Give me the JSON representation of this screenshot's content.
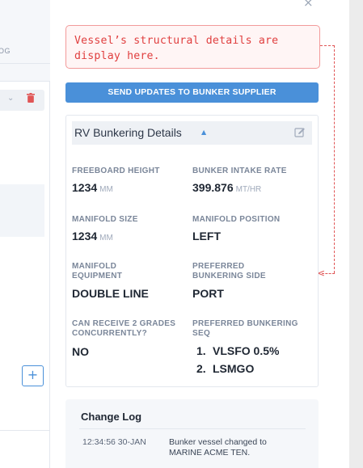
{
  "left": {
    "tab_fragment": "OG",
    "add_label": "+"
  },
  "close_label": "×",
  "tooltip": {
    "text": "Vessel’s structural details are display here."
  },
  "send_button_label": "SEND UPDATES TO BUNKER SUPPLIER",
  "details": {
    "title": "RV Bunkering Details",
    "fields": {
      "freeboard_height": {
        "label": "FREEBOARD HEIGHT",
        "value": "1234",
        "unit": "MM"
      },
      "bunker_intake_rate": {
        "label": "BUNKER INTAKE RATE",
        "value": "399.876",
        "unit": "MT/HR"
      },
      "manifold_size": {
        "label": "MANIFOLD SIZE",
        "value": "1234",
        "unit": "MM"
      },
      "manifold_position": {
        "label": "MANIFOLD POSITION",
        "value": "LEFT"
      },
      "manifold_equipment": {
        "label_line1": "MANIFOLD",
        "label_line2": "EQUIPMENT",
        "value": "DOUBLE LINE"
      },
      "preferred_side": {
        "label_line1": "PREFERRED",
        "label_line2": "BUNKERING SIDE",
        "value": "PORT"
      },
      "receive_grades": {
        "label_line1": "CAN RECEIVE 2 GRADES",
        "label_line2": "CONCURRENTLY?",
        "value": "NO"
      },
      "preferred_seq": {
        "label_line1": "PREFERRED BUNKERING",
        "label_line2": "SEQ",
        "items": [
          {
            "num": "1.",
            "text": "VLSFO 0.5%"
          },
          {
            "num": "2.",
            "text": "LSMGO"
          }
        ]
      }
    }
  },
  "changelog": {
    "title": "Change Log",
    "entries": [
      {
        "time": "12:34:56 30-JAN",
        "message": "Bunker vessel changed to MARINE ACME TEN."
      }
    ]
  },
  "colors": {
    "accent": "#4a90d9",
    "annotation": "#e03f3f",
    "delete": "#e05555"
  }
}
